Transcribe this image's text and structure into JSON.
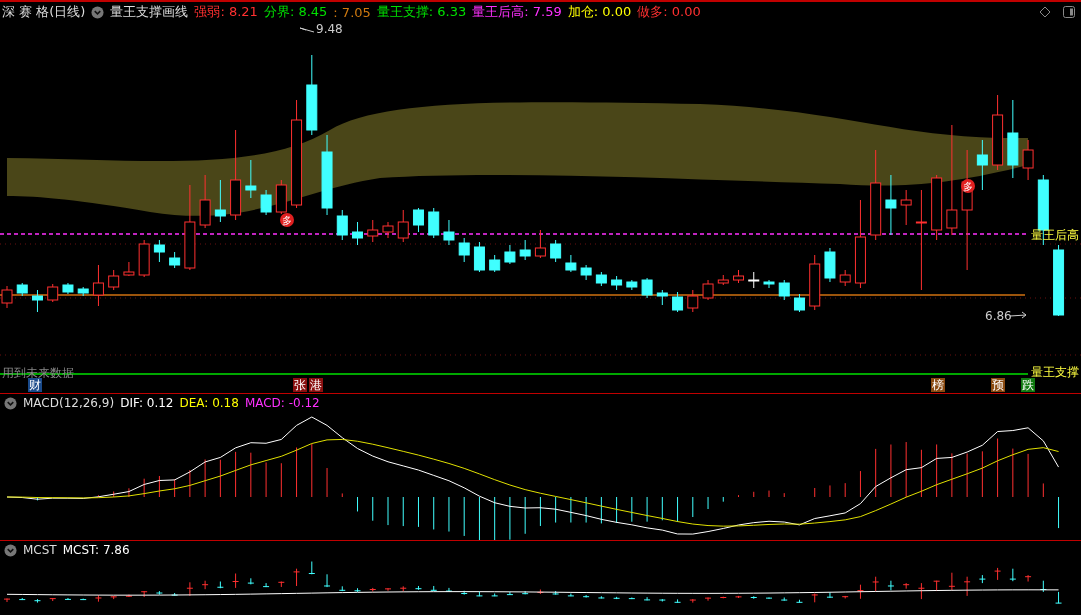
{
  "header": {
    "stock": "深 赛 格(日线)",
    "indicator": "量王支撑画线",
    "values": [
      {
        "text": "强弱: 8.21",
        "color": "#ff3030"
      },
      {
        "text": "分界: 8.45",
        "color": "#00e000"
      },
      {
        "text": ": 7.05",
        "color": "#d07a10"
      },
      {
        "text": "量王支撑: 6.33",
        "color": "#00e000"
      },
      {
        "text": "量王后高: 7.59",
        "color": "#ff30ff"
      },
      {
        "text": "加仓: 0.00",
        "color": "#ffff00"
      },
      {
        "text": "做多: 0.00",
        "color": "#ff3030"
      }
    ]
  },
  "main_chart": {
    "high_label": "9.48",
    "low_label": "6.86",
    "resistance_label": "量王后高",
    "future_note": "用到未来数据",
    "support_label": "量王支撑",
    "buy_marks": [
      "多",
      "多"
    ]
  },
  "signals": [
    {
      "text": "财",
      "color": "#1a4a8a"
    },
    {
      "text": "张",
      "color": "#8a1010"
    },
    {
      "text": "港",
      "color": "#8a1010"
    },
    {
      "text": "榜",
      "color": "#8a4a10"
    },
    {
      "text": "预",
      "color": "#8a4a10"
    },
    {
      "text": "跌",
      "color": "#107a10"
    }
  ],
  "macd": {
    "title": "MACD(12,26,9)",
    "values": [
      {
        "text": "DIF: 0.12",
        "color": "#ffffff"
      },
      {
        "text": "DEA: 0.18",
        "color": "#ffff00"
      },
      {
        "text": "MACD: -0.12",
        "color": "#ff30ff"
      }
    ]
  },
  "mcst": {
    "title": "MCST",
    "values": [
      {
        "text": "MCST: 7.86",
        "color": "#ffffff"
      }
    ]
  }
}
